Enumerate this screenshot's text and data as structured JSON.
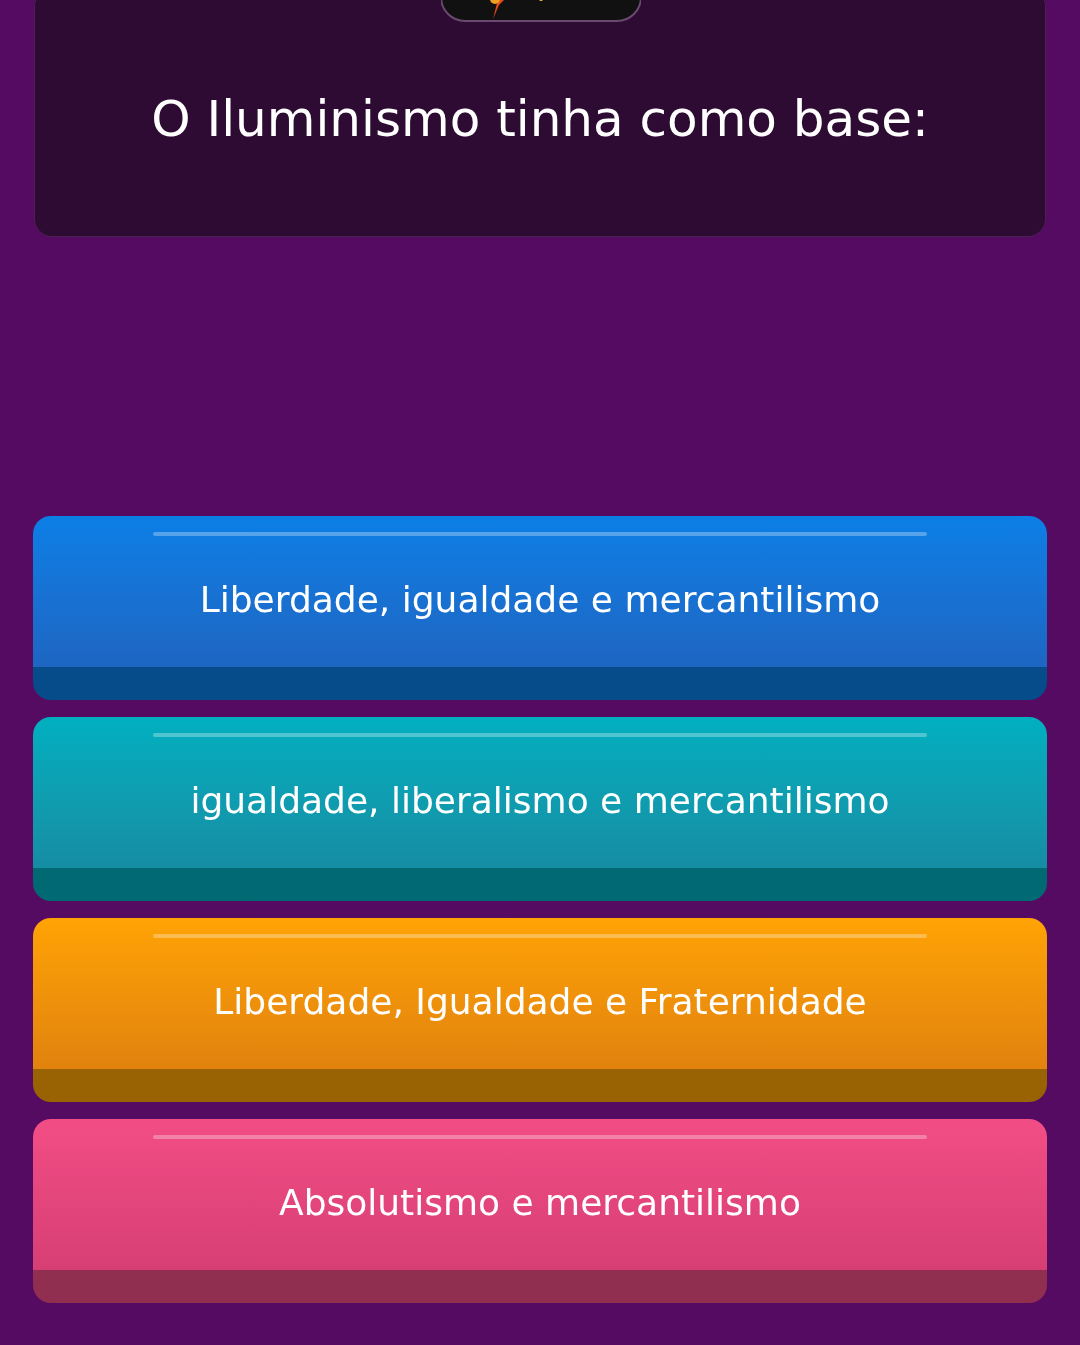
{
  "question": {
    "text": "O Iluminismo tinha como base:"
  },
  "options": [
    {
      "label": "Liberdade, igualdade e mercantilismo",
      "color": "#0a7fe6"
    },
    {
      "label": "igualdade, liberalismo e mercantilismo",
      "color": "#00b0c0"
    },
    {
      "label": "Liberdade, Igualdade e Fraternidade",
      "color": "#ffa305"
    },
    {
      "label": "Absolutismo e mercantilismo",
      "color": "#f24e85"
    }
  ]
}
